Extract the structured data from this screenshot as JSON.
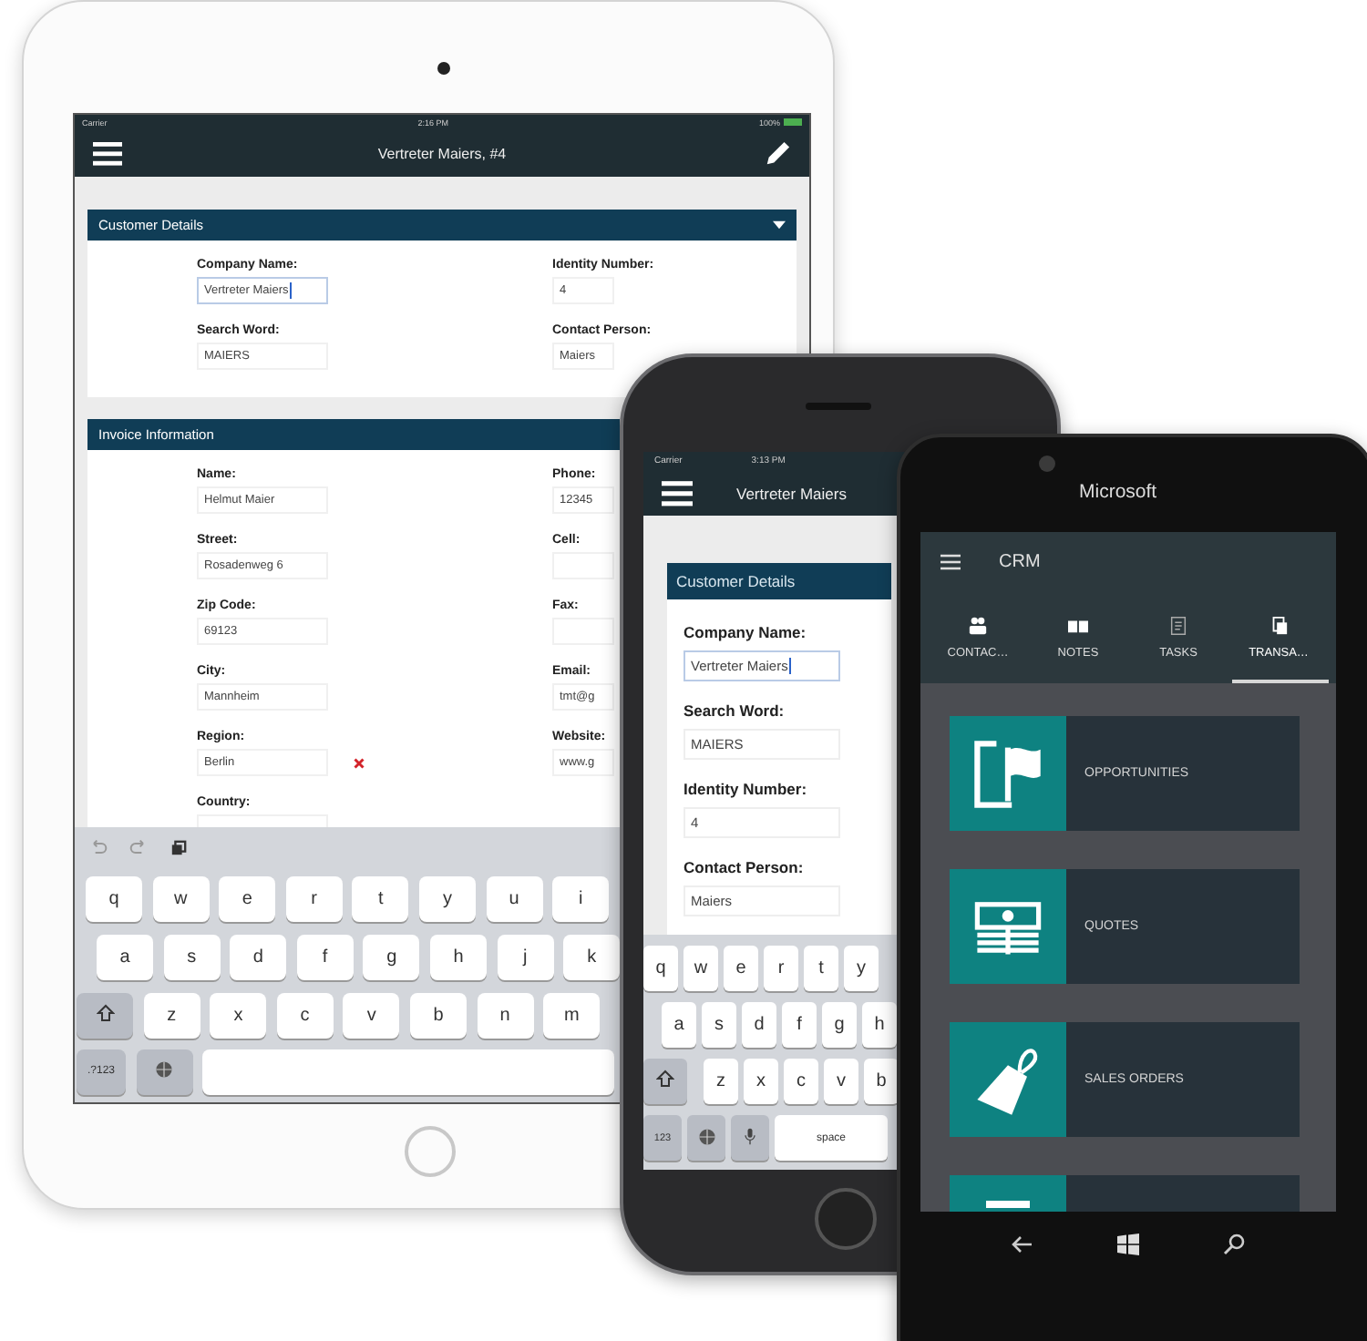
{
  "tablet": {
    "status_bar": {
      "carrier": "Carrier",
      "time": "2:16 PM",
      "battery": "100%"
    },
    "title": "Vertreter Maiers, #4",
    "sections": [
      {
        "title": "Customer Details",
        "toggle": true,
        "left_fields": [
          {
            "label": "Company Name:",
            "value": "Vertreter Maiers",
            "focused": true,
            "kind": "text"
          },
          {
            "label": "Search Word:",
            "value": "MAIERS",
            "focused": false,
            "kind": "text"
          }
        ],
        "right_fields": [
          {
            "label": "Identity Number:",
            "value": "4",
            "focused": false
          },
          {
            "label": "Contact Person:",
            "value": "Maiers",
            "focused": false
          }
        ]
      },
      {
        "title": "Invoice Information",
        "toggle": false,
        "left_fields": [
          {
            "label": "Name:",
            "value": "Helmut Maier",
            "focused": false,
            "kind": "text"
          },
          {
            "label": "Street:",
            "value": "Rosadenweg 6",
            "focused": false,
            "kind": "text"
          },
          {
            "label": "Zip Code:",
            "value": "69123",
            "focused": false,
            "kind": "text"
          },
          {
            "label": "City:",
            "value": "Mannheim",
            "focused": false,
            "kind": "text"
          },
          {
            "label": "Region:",
            "value": "Berlin",
            "focused": false,
            "kind": "clearable"
          },
          {
            "label": "Country:",
            "focused": false,
            "kind": "text"
          }
        ],
        "right_fields": [
          {
            "label": "Phone:",
            "value": "12345",
            "focused": false
          },
          {
            "label": "Cell:",
            "focused": false
          },
          {
            "label": "Fax:",
            "focused": false
          },
          {
            "label": "Email:",
            "value": "tmt@g",
            "focused": false
          },
          {
            "label": "Website:",
            "value": "www.g",
            "focused": false
          }
        ]
      }
    ],
    "keyboard": {
      "rows": [
        [
          "q",
          "w",
          "e",
          "r",
          "t",
          "y",
          "u",
          "i"
        ],
        [
          "a",
          "s",
          "d",
          "f",
          "g",
          "h",
          "j",
          "k"
        ],
        [
          "z",
          "x",
          "c",
          "v",
          "b",
          "n",
          "m"
        ]
      ],
      "numbers_key": ".?123"
    }
  },
  "phone": {
    "status_bar": {
      "carrier": "Carrier",
      "time": "3:13 PM"
    },
    "title": "Vertreter Maiers",
    "section": {
      "title": "Customer Details",
      "fields": [
        {
          "label": "Company Name:",
          "value": "Vertreter Maiers",
          "focused": true
        },
        {
          "label": "Search Word:",
          "value": "MAIERS",
          "focused": false
        },
        {
          "label": "Identity Number:",
          "value": "4",
          "focused": false
        },
        {
          "label": "Contact Person:",
          "value": "Maiers",
          "focused": false
        }
      ]
    },
    "keyboard": {
      "rows": [
        [
          "q",
          "w",
          "e",
          "r",
          "t",
          "y"
        ],
        [
          "a",
          "s",
          "d",
          "f",
          "g",
          "h"
        ],
        [
          "z",
          "x",
          "c",
          "v",
          "b"
        ]
      ],
      "numbers_key": "123",
      "space_key": "space"
    }
  },
  "windows_phone": {
    "brand": "Microsoft",
    "app_title": "CRM",
    "tabs": [
      {
        "label": "CONTAC…",
        "selected": false
      },
      {
        "label": "NOTES",
        "selected": false
      },
      {
        "label": "TASKS",
        "selected": false
      },
      {
        "label": "TRANSA…",
        "selected": true
      }
    ],
    "tiles": [
      {
        "label": "OPPORTUNITIES",
        "kind": "full"
      },
      {
        "label": "QUOTES",
        "kind": "full"
      },
      {
        "label": "SALES ORDERS",
        "kind": "full"
      },
      {
        "kind": "partial"
      }
    ]
  }
}
